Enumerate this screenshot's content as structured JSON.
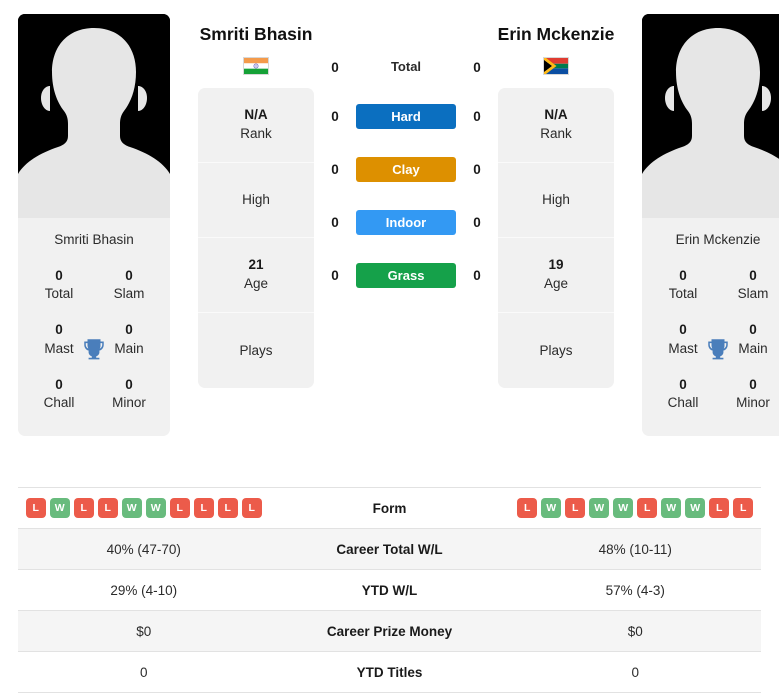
{
  "players": [
    {
      "name": "Smriti Bhasin",
      "avatar_name": "Smriti Bhasin",
      "country": "India",
      "flag_icon": "flag-india",
      "rank_value": "N/A",
      "rank_label": "Rank",
      "high_label": "High",
      "age_value": "21",
      "age_label": "Age",
      "plays_label": "Plays",
      "trophies": [
        {
          "num": "0",
          "label": "Total"
        },
        {
          "num": "0",
          "label": "Slam"
        },
        {
          "num": "0",
          "label": "Mast"
        },
        {
          "num": "0",
          "label": "Main"
        },
        {
          "num": "0",
          "label": "Chall"
        },
        {
          "num": "0",
          "label": "Minor"
        }
      ],
      "form": [
        "L",
        "W",
        "L",
        "L",
        "W",
        "W",
        "L",
        "L",
        "L",
        "L"
      ],
      "career_total_wl": "40% (47-70)",
      "ytd_wl": "29% (4-10)",
      "career_prize_money": "$0",
      "ytd_titles": "0"
    },
    {
      "name": "Erin Mckenzie",
      "avatar_name": "Erin Mckenzie",
      "country": "South Africa",
      "flag_icon": "flag-south-africa",
      "rank_value": "N/A",
      "rank_label": "Rank",
      "high_label": "High",
      "age_value": "19",
      "age_label": "Age",
      "plays_label": "Plays",
      "trophies": [
        {
          "num": "0",
          "label": "Total"
        },
        {
          "num": "0",
          "label": "Slam"
        },
        {
          "num": "0",
          "label": "Mast"
        },
        {
          "num": "0",
          "label": "Main"
        },
        {
          "num": "0",
          "label": "Chall"
        },
        {
          "num": "0",
          "label": "Minor"
        }
      ],
      "form": [
        "L",
        "W",
        "L",
        "W",
        "W",
        "L",
        "W",
        "W",
        "L",
        "L"
      ],
      "career_total_wl": "48% (10-11)",
      "ytd_wl": "57% (4-3)",
      "career_prize_money": "$0",
      "ytd_titles": "0"
    }
  ],
  "h2h": [
    {
      "label": "Total",
      "left": "0",
      "right": "0",
      "style": "plain",
      "color": ""
    },
    {
      "label": "Hard",
      "left": "0",
      "right": "0",
      "style": "chip",
      "color": "#0b6fc0"
    },
    {
      "label": "Clay",
      "left": "0",
      "right": "0",
      "style": "chip",
      "color": "#dd9000"
    },
    {
      "label": "Indoor",
      "left": "0",
      "right": "0",
      "style": "chip",
      "color": "#3399f3"
    },
    {
      "label": "Grass",
      "left": "0",
      "right": "0",
      "style": "chip",
      "color": "#15a14a"
    }
  ],
  "table": {
    "rows": [
      {
        "label": "Form",
        "type": "form"
      },
      {
        "label": "Career Total W/L",
        "type": "text",
        "left": "40% (47-70)",
        "right": "48% (10-11)"
      },
      {
        "label": "YTD W/L",
        "type": "text",
        "left": "29% (4-10)",
        "right": "57% (4-3)"
      },
      {
        "label": "Career Prize Money",
        "type": "text",
        "left": "$0",
        "right": "$0"
      },
      {
        "label": "YTD Titles",
        "type": "text",
        "left": "0",
        "right": "0"
      }
    ]
  },
  "colors": {
    "win_badge": "#68bb7d",
    "loss_badge": "#ec5b4a",
    "trophy": "#4a7ebb",
    "card_bg": "#f1f1f1",
    "row_alt_bg": "#f5f5f5"
  }
}
